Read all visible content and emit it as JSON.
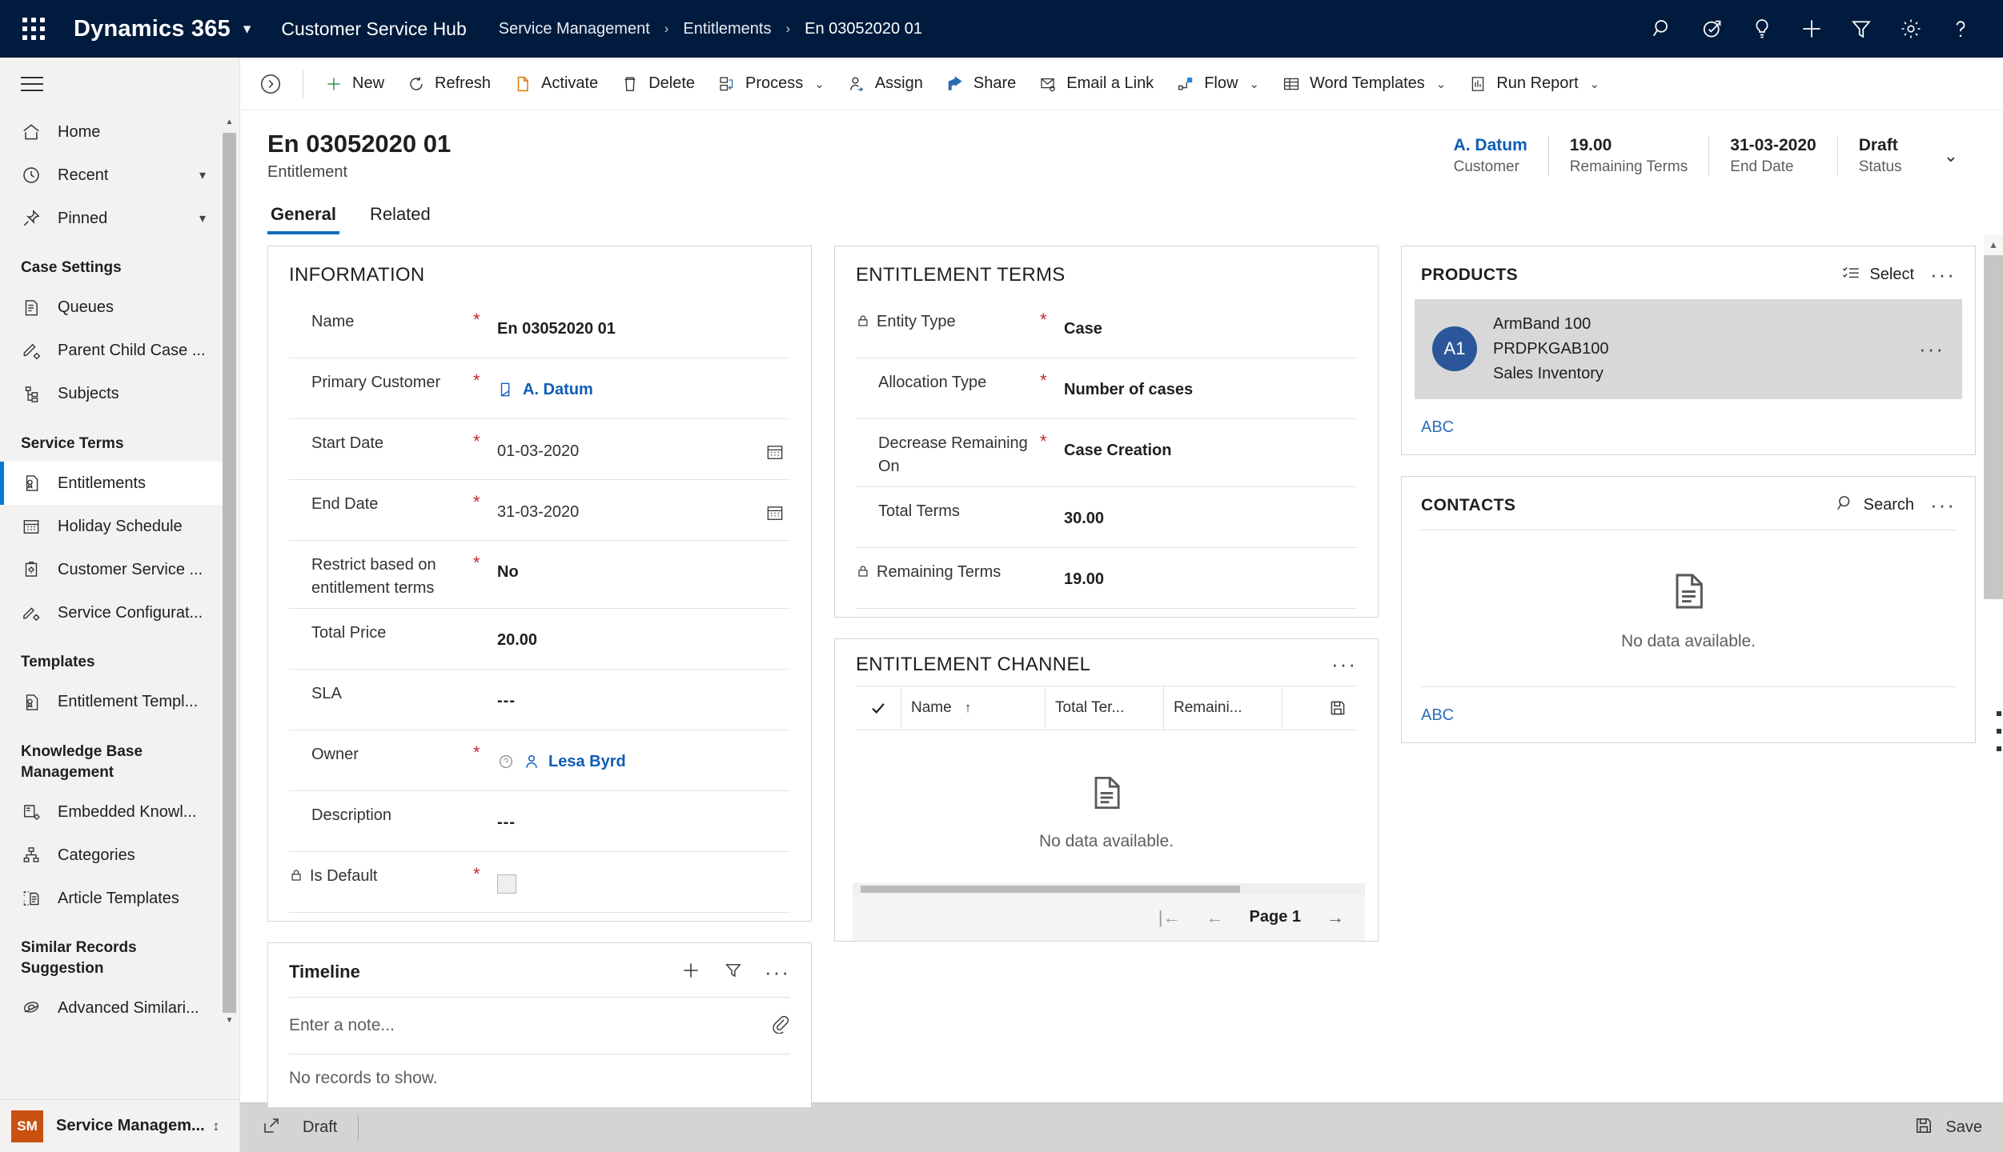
{
  "topbar": {
    "waffle_label": "app-launcher",
    "brand": "Dynamics 365",
    "app_name": "Customer Service Hub",
    "breadcrumbs": [
      "Service Management",
      "Entitlements",
      "En 03052020 01"
    ],
    "separator": "›",
    "icons": [
      "search-icon",
      "relevance-search-icon",
      "lightbulb-icon",
      "plus-icon",
      "filter-icon",
      "gear-icon",
      "help-icon"
    ]
  },
  "sidebar": {
    "top_items": [
      {
        "label": "Home",
        "icon": "home-icon",
        "chevron": ""
      },
      {
        "label": "Recent",
        "icon": "clock-icon",
        "chevron": "⌄"
      },
      {
        "label": "Pinned",
        "icon": "pin-icon",
        "chevron": "⌄"
      }
    ],
    "groups": [
      {
        "title": "Case Settings",
        "items": [
          {
            "label": "Queues",
            "icon": "queue-icon"
          },
          {
            "label": "Parent Child Case ...",
            "icon": "parent-child-case-icon"
          },
          {
            "label": "Subjects",
            "icon": "subjects-icon"
          }
        ]
      },
      {
        "title": "Service Terms",
        "items": [
          {
            "label": "Entitlements",
            "icon": "entitlement-icon",
            "active": true
          },
          {
            "label": "Holiday Schedule",
            "icon": "calendar-icon"
          },
          {
            "label": "Customer Service ...",
            "icon": "customer-service-icon"
          },
          {
            "label": "Service Configurat...",
            "icon": "service-config-icon"
          }
        ]
      },
      {
        "title": "Templates",
        "items": [
          {
            "label": "Entitlement Templ...",
            "icon": "entitlement-template-icon"
          }
        ]
      },
      {
        "title": "Knowledge Base Management",
        "items": [
          {
            "label": "Embedded Knowl...",
            "icon": "embedded-knowledge-icon"
          },
          {
            "label": "Categories",
            "icon": "categories-icon"
          },
          {
            "label": "Article Templates",
            "icon": "article-template-icon"
          }
        ]
      },
      {
        "title": "Similar Records Suggestion",
        "items": [
          {
            "label": "Advanced Similari...",
            "icon": "advanced-similarity-icon"
          }
        ]
      }
    ],
    "footer": {
      "initials": "SM",
      "label": "Service Managem...",
      "chevron": "⌃⌄"
    }
  },
  "commandbar": {
    "collapse_icon": "collapse-right-icon",
    "buttons": [
      {
        "label": "New",
        "icon": "plus-icon",
        "caret": false
      },
      {
        "label": "Refresh",
        "icon": "refresh-icon",
        "caret": false
      },
      {
        "label": "Activate",
        "icon": "activate-icon",
        "caret": false
      },
      {
        "label": "Delete",
        "icon": "trash-icon",
        "caret": false
      },
      {
        "label": "Process",
        "icon": "process-icon",
        "caret": true
      },
      {
        "label": "Assign",
        "icon": "assign-user-icon",
        "caret": false
      },
      {
        "label": "Share",
        "icon": "share-icon",
        "caret": false
      },
      {
        "label": "Email a Link",
        "icon": "email-link-icon",
        "caret": false
      },
      {
        "label": "Flow",
        "icon": "flow-icon",
        "caret": true
      },
      {
        "label": "Word Templates",
        "icon": "word-template-icon",
        "caret": true
      },
      {
        "label": "Run Report",
        "icon": "run-report-icon",
        "caret": true
      }
    ],
    "caret": "⌄"
  },
  "record": {
    "title": "En 03052020 01",
    "subtitle": "Entitlement",
    "header_fields": [
      {
        "value": "A. Datum",
        "label": "Customer",
        "link": true
      },
      {
        "value": "19.00",
        "label": "Remaining Terms",
        "link": false
      },
      {
        "value": "31-03-2020",
        "label": "End Date",
        "link": false
      },
      {
        "value": "Draft",
        "label": "Status",
        "link": false
      }
    ],
    "header_chevron": "⌄",
    "tabs": [
      {
        "label": "General",
        "active": true
      },
      {
        "label": "Related",
        "active": false
      }
    ]
  },
  "information": {
    "title": "INFORMATION",
    "fields": [
      {
        "label": "Name",
        "required": true,
        "value": "En 03052020 01",
        "kind": "text"
      },
      {
        "label": "Primary Customer",
        "required": true,
        "value": "A. Datum",
        "kind": "lookup-account"
      },
      {
        "label": "Start Date",
        "required": true,
        "value": "01-03-2020",
        "kind": "date"
      },
      {
        "label": "End Date",
        "required": true,
        "value": "31-03-2020",
        "kind": "date"
      },
      {
        "label": "Restrict based on entitlement terms",
        "required": true,
        "value": "No",
        "kind": "text"
      },
      {
        "label": "Total Price",
        "required": false,
        "value": "20.00",
        "kind": "text"
      },
      {
        "label": "SLA",
        "required": false,
        "value": "---",
        "kind": "dash"
      },
      {
        "label": "Owner",
        "required": true,
        "value": "Lesa Byrd",
        "kind": "lookup-user"
      },
      {
        "label": "Description",
        "required": false,
        "value": "---",
        "kind": "dash"
      },
      {
        "label": "Is Default",
        "required": true,
        "value": "",
        "kind": "checkbox",
        "locked": true
      }
    ]
  },
  "entitlement_terms": {
    "title": "ENTITLEMENT TERMS",
    "fields": [
      {
        "label": "Entity Type",
        "required": true,
        "value": "Case",
        "locked": true
      },
      {
        "label": "Allocation Type",
        "required": true,
        "value": "Number of cases",
        "locked": false
      },
      {
        "label": "Decrease Remaining On",
        "required": true,
        "value": "Case Creation",
        "locked": false
      },
      {
        "label": "Total Terms",
        "required": false,
        "value": "30.00",
        "locked": false
      },
      {
        "label": "Remaining Terms",
        "required": false,
        "value": "19.00",
        "locked": true
      }
    ]
  },
  "entitlement_channel": {
    "title": "ENTITLEMENT CHANNEL",
    "columns": [
      "Name",
      "Total Ter...",
      "Remaini..."
    ],
    "sort_indicator": "↑",
    "empty_message": "No data available.",
    "pager": {
      "first": "|←",
      "prev": "←",
      "page": "Page 1",
      "next": "→"
    },
    "save_icon": "save-icon",
    "more": "···"
  },
  "products": {
    "title": "PRODUCTS",
    "select_label": "Select",
    "select_icon": "select-list-icon",
    "more": "···",
    "items": [
      {
        "initials": "A1",
        "name": "ArmBand 100",
        "code": "PRDPKGAB100",
        "unit": "Sales Inventory",
        "more": "···"
      }
    ],
    "footer_link": "ABC"
  },
  "contacts": {
    "title": "CONTACTS",
    "search_label": "Search",
    "search_icon": "search-icon",
    "more": "···",
    "empty_message": "No data available.",
    "footer_link": "ABC"
  },
  "timeline": {
    "title": "Timeline",
    "add_icon": "plus-icon",
    "filter_icon": "filter-icon",
    "more": "···",
    "note_placeholder": "Enter a note...",
    "attach_icon": "paperclip-icon",
    "empty_message": "No records to show."
  },
  "statusbar": {
    "expand_icon": "popout-icon",
    "state": "Draft",
    "save_label": "Save",
    "save_icon": "save-icon"
  },
  "colors": {
    "nav_bg": "#001B3D",
    "accent": "#0f6cbd",
    "link": "#0f5db4",
    "required": "#c4272d",
    "sidebar_bg": "#f3f2f1",
    "avatar_bg": "#2b579a",
    "footer_square": "#ca5010"
  }
}
